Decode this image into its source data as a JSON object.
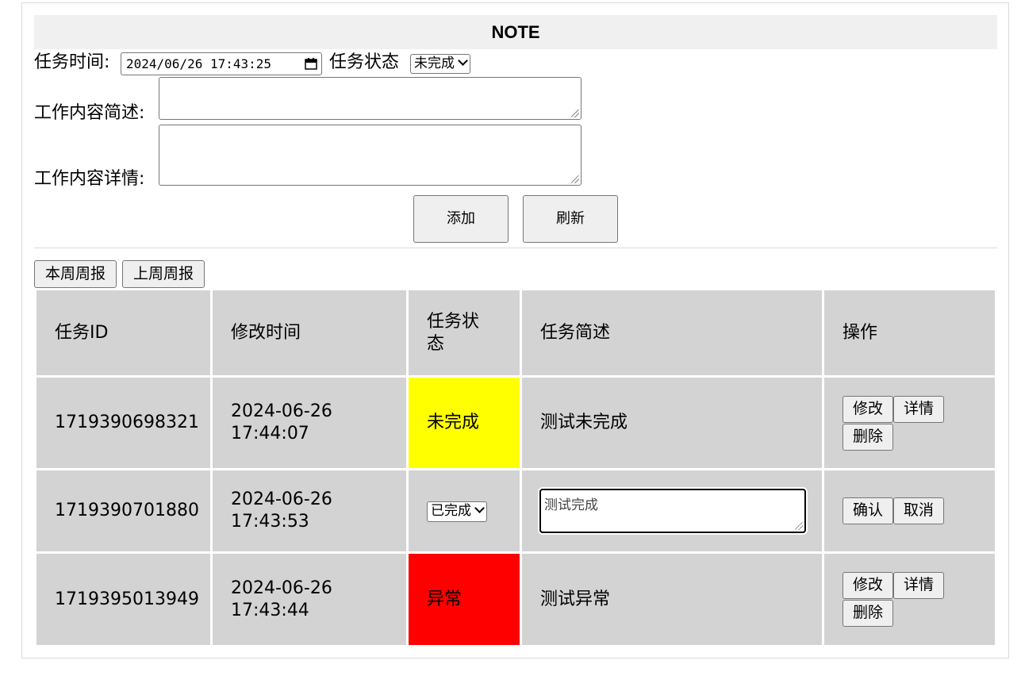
{
  "header": {
    "title": "NOTE"
  },
  "form": {
    "time_label": "任务时间:",
    "time_value": "2024/06/26 17:43:25",
    "status_label": "任务状态",
    "status_value": "未完成",
    "summary_label": "工作内容简述:",
    "detail_label": "工作内容详情:",
    "add_label": "添加",
    "refresh_label": "刷新"
  },
  "reports": {
    "this_week": "本周周报",
    "last_week": "上周周报"
  },
  "table": {
    "headers": [
      "任务ID",
      "修改时间",
      "任务状态",
      "任务简述",
      "操作"
    ],
    "rows": [
      {
        "id": "1719390698321",
        "date": "2024-06-26",
        "time": "17:44:07",
        "status": "未完成",
        "status_color": "#ffff00",
        "summary": "测试未完成",
        "actions": [
          "修改",
          "详情",
          "删除"
        ]
      },
      {
        "id": "1719390701880",
        "date": "2024-06-26",
        "time": "17:43:53",
        "status": "已完成",
        "summary": "测试完成",
        "actions": [
          "确认",
          "取消"
        ]
      },
      {
        "id": "1719395013949",
        "date": "2024-06-26",
        "time": "17:43:44",
        "status": "异常",
        "status_color": "#ff0000",
        "summary": "测试异常",
        "actions": [
          "修改",
          "详情",
          "删除"
        ]
      }
    ]
  }
}
